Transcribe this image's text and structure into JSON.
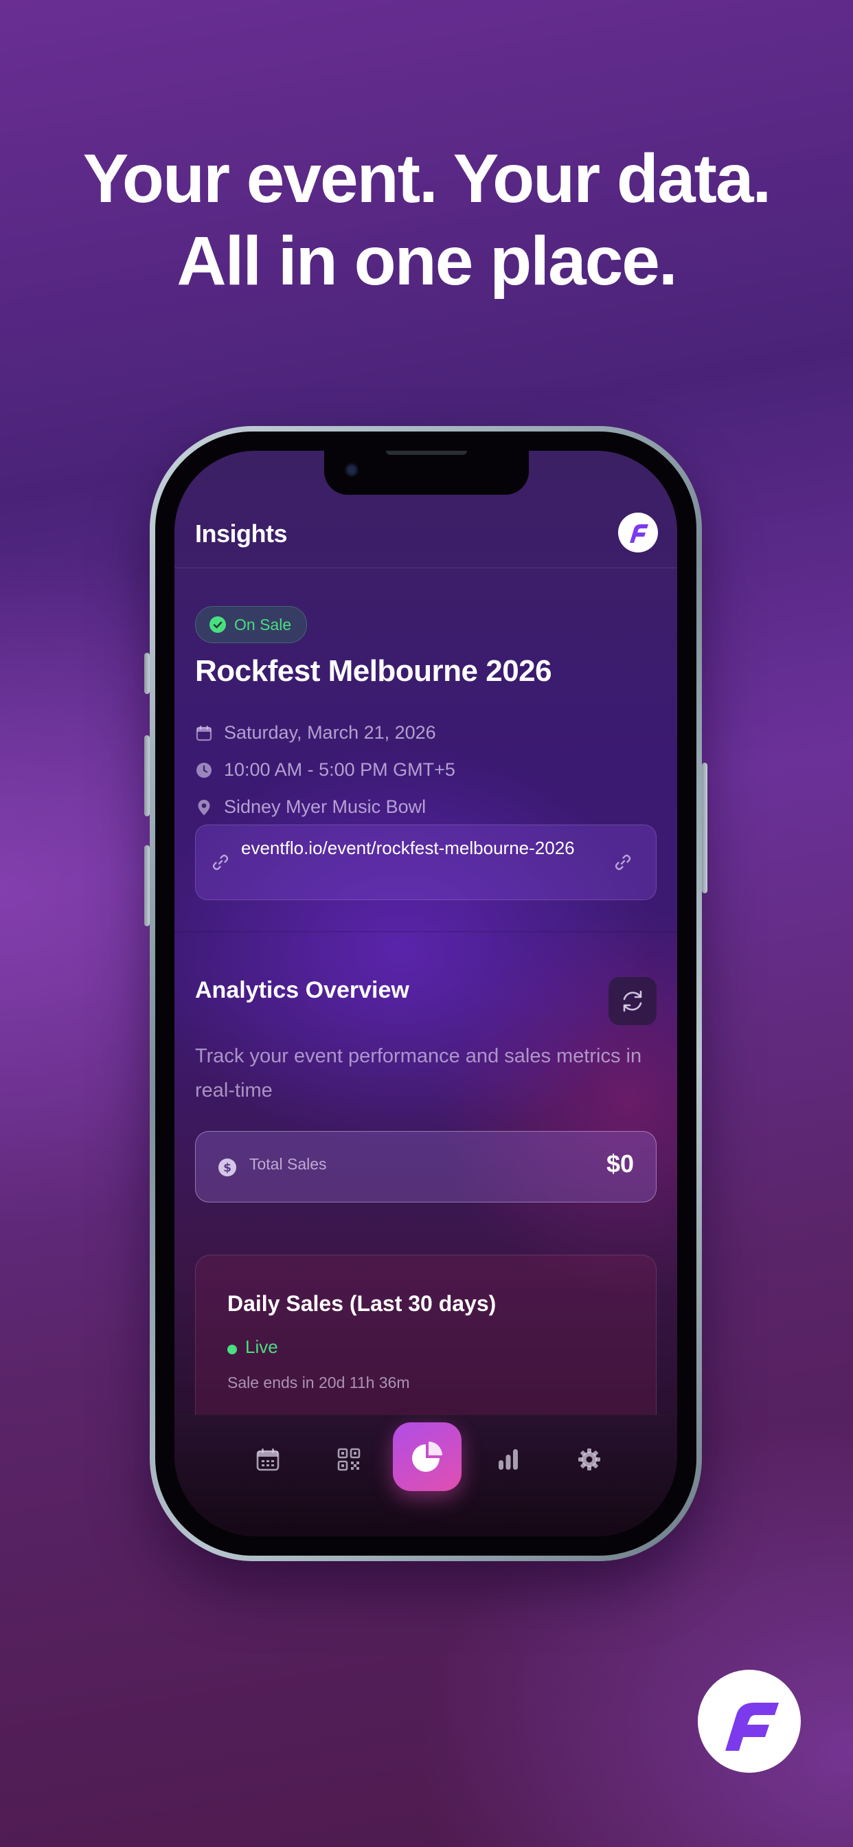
{
  "headline": {
    "line1": "Your event. Your data.",
    "line2": "All in one place."
  },
  "app": {
    "title": "Insights",
    "logo_icon": "eventflo-logo-icon"
  },
  "event": {
    "status": "On Sale",
    "title": "Rockfest Melbourne 2026",
    "date": "Saturday, March 21, 2026",
    "time": "10:00 AM - 5:00 PM GMT+5",
    "venue": "Sidney Myer Music Bowl",
    "link": "eventflo.io/event/rockfest-melbourne-2026"
  },
  "analytics": {
    "title": "Analytics Overview",
    "description": "Track your event performance and sales metrics in real-time",
    "total_sales_label": "Total Sales",
    "total_sales_value": "$0"
  },
  "daily_sales": {
    "title": "Daily Sales (Last 30 days)",
    "status": "Live",
    "ends": "Sale ends in 20d 11h 36m"
  },
  "tabs": [
    {
      "icon": "calendar-icon",
      "active": false
    },
    {
      "icon": "qr-code-icon",
      "active": false
    },
    {
      "icon": "pie-chart-icon",
      "active": true
    },
    {
      "icon": "bar-chart-icon",
      "active": false
    },
    {
      "icon": "gear-icon",
      "active": false
    }
  ],
  "colors": {
    "accent_green": "#4ade80",
    "active_tab_start": "#b14ee6",
    "active_tab_end": "#e04fb0"
  }
}
